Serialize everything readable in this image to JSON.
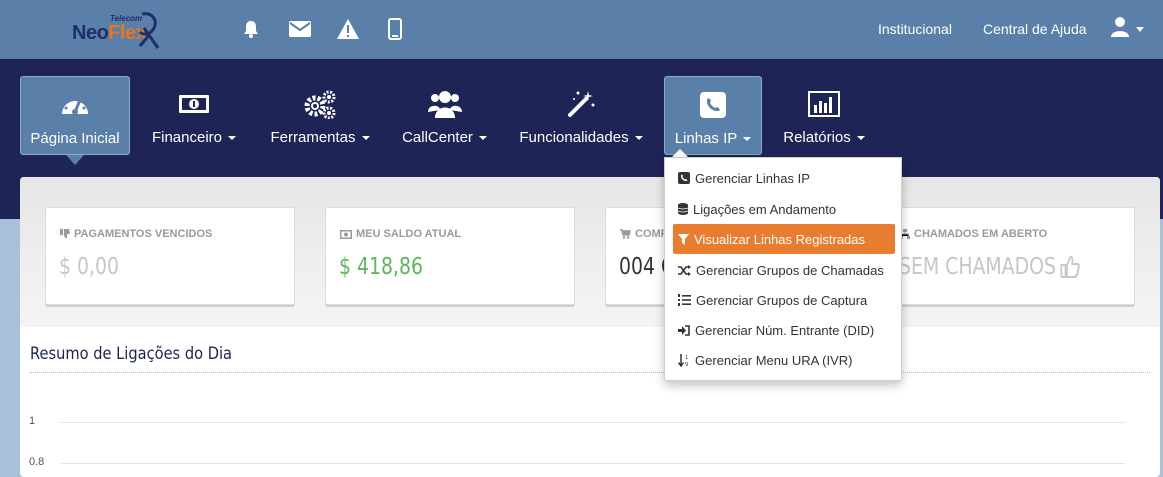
{
  "brand": {
    "name_part1": "Neo",
    "name_part2": "Flex",
    "tagline": "Telecom"
  },
  "top_icons": [
    "bell-icon",
    "envelope-icon",
    "warning-icon",
    "mobile-icon"
  ],
  "top_links": {
    "institucional": "Institucional",
    "help": "Central de Ajuda"
  },
  "nav": {
    "items": [
      {
        "label": "Página Inicial",
        "icon": "dashboard-icon"
      },
      {
        "label": "Financeiro",
        "icon": "money-icon"
      },
      {
        "label": "Ferramentas",
        "icon": "gears-icon"
      },
      {
        "label": "CallCenter",
        "icon": "users-icon"
      },
      {
        "label": "Funcionalidades",
        "icon": "magic-wand-icon"
      },
      {
        "label": "Linhas IP",
        "icon": "phone-square-icon"
      },
      {
        "label": "Relatórios",
        "icon": "bar-chart-icon"
      }
    ]
  },
  "cards": [
    {
      "title": "PAGAMENTOS VENCIDOS",
      "value": "$ 0,00",
      "icon": "thumbs-down-icon"
    },
    {
      "title": "MEU SALDO ATUAL",
      "value": "$ 418,86",
      "icon": "money-icon"
    },
    {
      "title": "COMP",
      "value": "004 C",
      "icon": "cart-icon"
    },
    {
      "title": "CHAMADOS EM ABERTO",
      "value": "SEM CHAMADOS",
      "icon": "sitemap-icon"
    }
  ],
  "section": {
    "title": "Resumo de Ligações do Dia"
  },
  "chart_data": {
    "type": "line",
    "yticks": [
      "1",
      "0.8"
    ],
    "series": []
  },
  "dropdown": {
    "items": [
      {
        "label": "Gerenciar Linhas IP",
        "icon": "phone-square-icon"
      },
      {
        "label": "Ligações em Andamento",
        "icon": "database-icon"
      },
      {
        "label": "Visualizar Linhas Registradas",
        "icon": "filter-icon",
        "active": true
      },
      {
        "label": "Gerenciar Grupos de Chamadas",
        "icon": "random-icon"
      },
      {
        "label": "Gerenciar Grupos de Captura",
        "icon": "list-ol-icon"
      },
      {
        "label": "Gerenciar Núm. Entrante (DID)",
        "icon": "sign-in-icon"
      },
      {
        "label": "Gerenciar Menu URA (IVR)",
        "icon": "sort-numeric-icon"
      }
    ]
  },
  "colors": {
    "topbar": "#5a7fa8",
    "navbar": "#1e2456",
    "accent": "#e97d2f",
    "positive": "#5cb85c"
  }
}
